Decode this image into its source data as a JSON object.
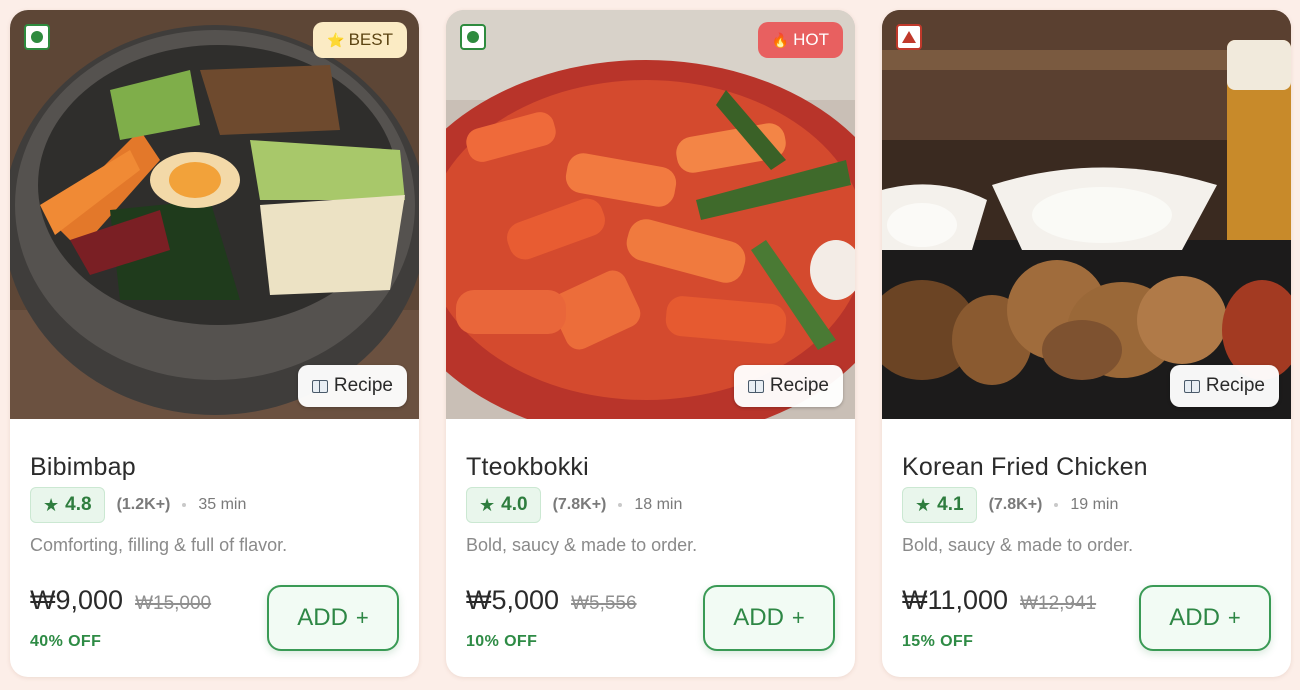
{
  "currency": "₩",
  "cards": [
    {
      "name": "Bibimbap",
      "diet": "veg",
      "badge": {
        "label": "BEST",
        "icon": "star-icon",
        "style": "best"
      },
      "recipe_label": "Recipe",
      "rating": "4.8",
      "reviews": "(1.2K+)",
      "time": "35 min",
      "desc": "Comforting, filling & full of flavor.",
      "price": "₩9,000",
      "old_price": "₩15,000",
      "discount": "40% OFF",
      "add_label": "ADD"
    },
    {
      "name": "Tteokbokki",
      "diet": "veg",
      "badge": {
        "label": "HOT",
        "icon": "fire-icon",
        "style": "hot"
      },
      "recipe_label": "Recipe",
      "rating": "4.0",
      "reviews": "(7.8K+)",
      "time": "18 min",
      "desc": "Bold, saucy & made to order.",
      "price": "₩5,000",
      "old_price": "₩5,556",
      "discount": "10% OFF",
      "add_label": "ADD"
    },
    {
      "name": "Korean Fried Chicken",
      "diet": "non-veg",
      "badge": null,
      "recipe_label": "Recipe",
      "rating": "4.1",
      "reviews": "(7.8K+)",
      "time": "19 min",
      "desc": "Bold, saucy & made to order.",
      "price": "₩11,000",
      "old_price": "₩12,941",
      "discount": "15% OFF",
      "add_label": "ADD"
    }
  ],
  "colors": {
    "page_bg": "#fceee8",
    "veg": "#2e8b3e",
    "non_veg": "#c0392b",
    "accent_green": "#2e8745",
    "best_badge": "#fbebc4",
    "hot_badge": "#e86060"
  }
}
